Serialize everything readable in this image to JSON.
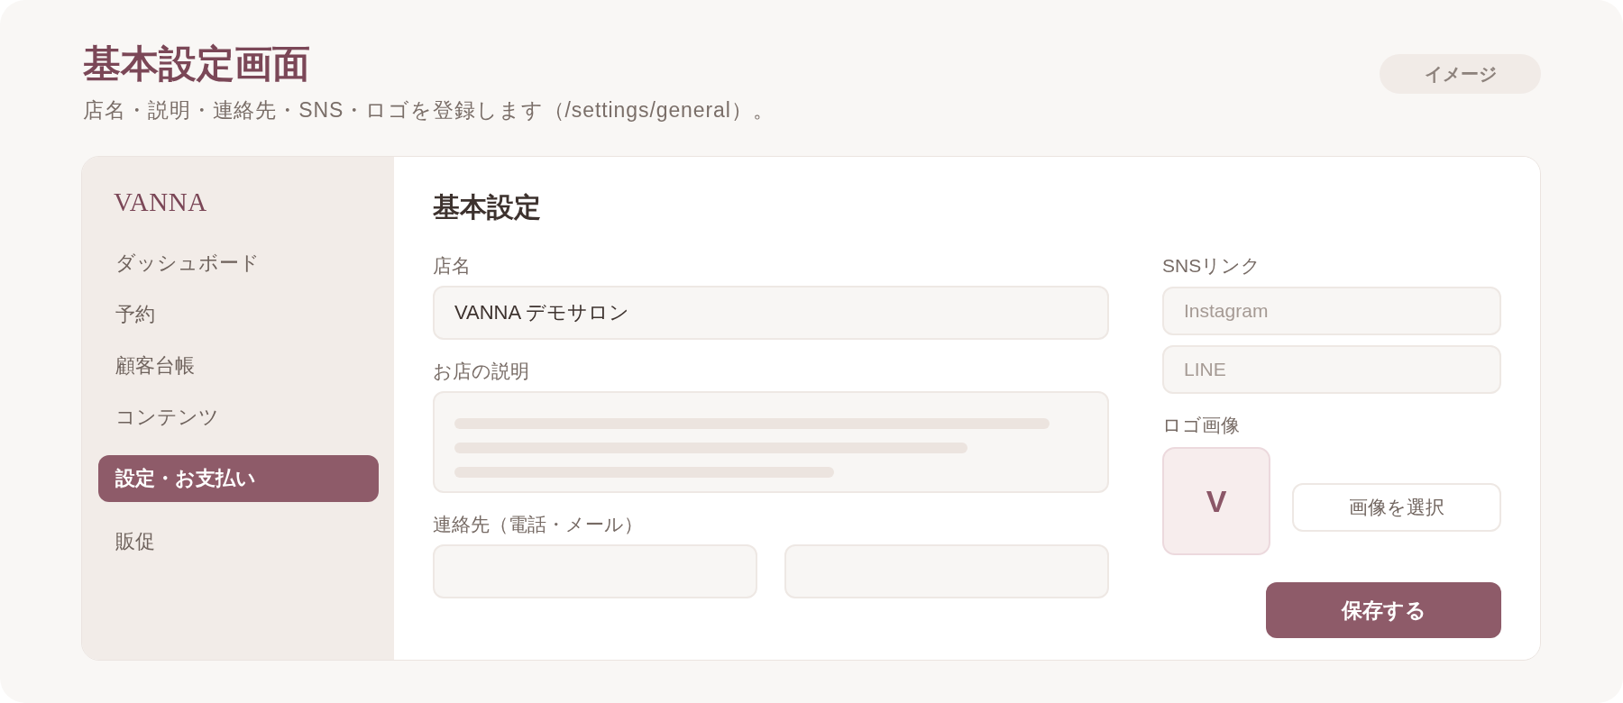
{
  "page": {
    "title": "基本設定画面",
    "subtitle": "店名・説明・連絡先・SNS・ロゴを登録します（/settings/general）。",
    "badge": "イメージ"
  },
  "sidebar": {
    "brand": "VANNA",
    "items": [
      {
        "label": "ダッシュボード",
        "selected": false
      },
      {
        "label": "予約",
        "selected": false
      },
      {
        "label": "顧客台帳",
        "selected": false
      },
      {
        "label": "コンテンツ",
        "selected": false
      },
      {
        "label": "設定・お支払い",
        "selected": true
      },
      {
        "label": "販促",
        "selected": false
      }
    ]
  },
  "form": {
    "title": "基本設定",
    "shop_name": {
      "label": "店名",
      "value": "VANNA デモサロン"
    },
    "description": {
      "label": "お店の説明"
    },
    "contact": {
      "label": "連絡先（電話・メール）"
    },
    "sns": {
      "label": "SNSリンク",
      "fields": [
        {
          "placeholder": "Instagram"
        },
        {
          "placeholder": "LINE"
        }
      ]
    },
    "logo": {
      "label": "ロゴ画像",
      "preview": "V",
      "button": "画像を選択"
    },
    "save_button": "保存する"
  }
}
